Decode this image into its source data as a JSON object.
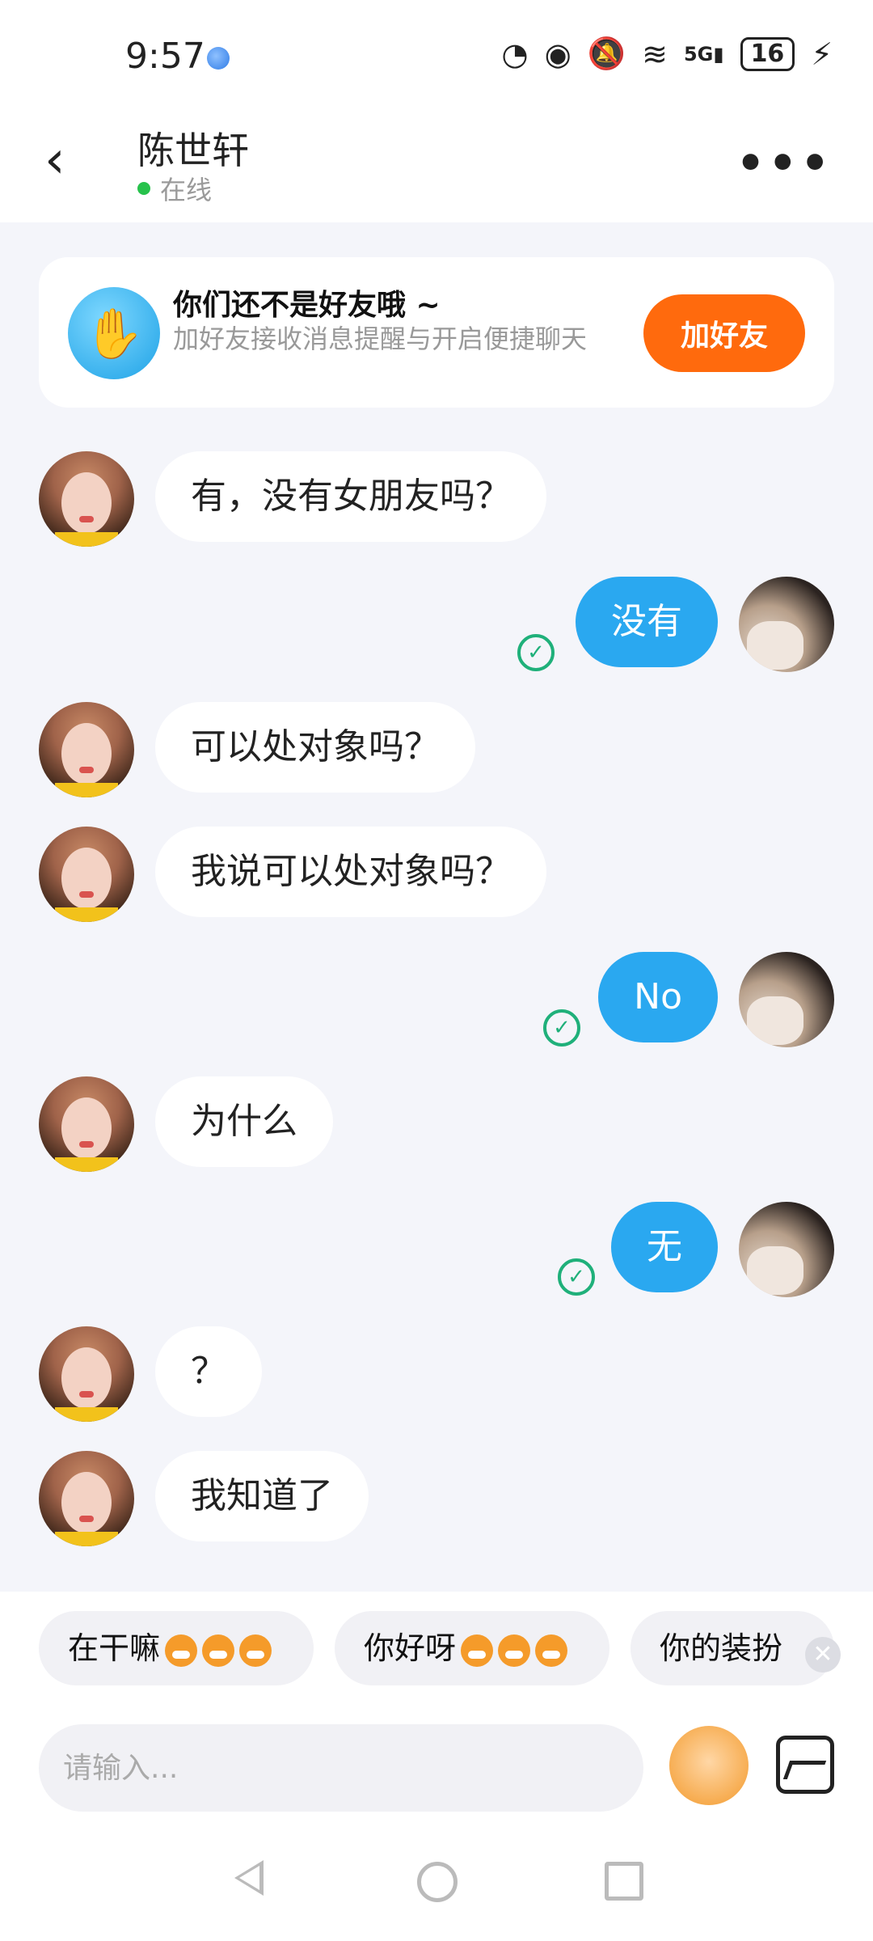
{
  "status": {
    "time": "9:57",
    "battery": "16",
    "network": "5G"
  },
  "header": {
    "title": "陈世轩",
    "status": "在线"
  },
  "banner": {
    "title": "你们还不是好友哦 ~",
    "subtitle": "加好友接收消息提醒与开启便捷聊天",
    "button": "加好友"
  },
  "messages": [
    {
      "from": "her",
      "text": "有，没有女朋友吗？"
    },
    {
      "from": "me",
      "text": "没有"
    },
    {
      "from": "her",
      "text": "可以处对象吗？"
    },
    {
      "from": "her",
      "text": "我说可以处对象吗？"
    },
    {
      "from": "me",
      "text": "No"
    },
    {
      "from": "her",
      "text": "为什么"
    },
    {
      "from": "me",
      "text": "无"
    },
    {
      "from": "her",
      "text": "？"
    },
    {
      "from": "her",
      "text": "我知道了"
    }
  ],
  "quick_replies": [
    {
      "text": "在干嘛"
    },
    {
      "text": "你好呀"
    },
    {
      "text": "你的装扮"
    }
  ],
  "input": {
    "placeholder": "请输入..."
  },
  "colors": {
    "accent": "#2aa8f0",
    "add_button": "#ff6a0d",
    "online": "#27c24c",
    "read": "#1fb07a"
  }
}
